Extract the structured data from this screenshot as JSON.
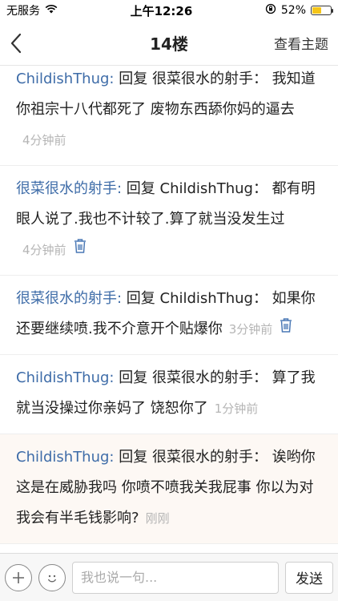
{
  "status_bar": {
    "carrier": "无服务",
    "time": "上午12:26",
    "battery_percent": "52%",
    "battery_level": 0.52,
    "icons": [
      "wifi-icon",
      "rotation-lock-icon",
      "battery-icon"
    ]
  },
  "nav": {
    "back_icon": "chevron-left-icon",
    "title": "14楼",
    "action_label": "查看主题"
  },
  "comments": [
    {
      "author": "ChildishThug:",
      "text": " 回复 很菜很水的射手： 我知道你祖宗十八代都死了 废物东西舔你妈的逼去",
      "time": "4分钟前",
      "deletable": false
    },
    {
      "author": "很菜很水的射手:",
      "text": " 回复 ChildishThug： 都有明眼人说了.我也不计较了.算了就当没发生过",
      "time": "4分钟前",
      "deletable": true
    },
    {
      "author": "很菜很水的射手:",
      "text": " 回复 ChildishThug： 如果你还要继续喷.我不介意开个贴爆你",
      "time": "3分钟前",
      "deletable": true
    },
    {
      "author": "ChildishThug:",
      "text": " 回复 很菜很水的射手： 算了我就当没操过你亲妈了 饶恕你了",
      "time": "1分钟前",
      "deletable": false
    },
    {
      "author": "ChildishThug:",
      "text": " 回复 很菜很水的射手： 诶哟你这是在威胁我吗 你喷不喷我关我屁事 你以为对我会有半毛钱影响?",
      "time": "刚刚",
      "deletable": false,
      "highlighted": true
    }
  ],
  "bottom_bar": {
    "add_icon": "plus-icon",
    "emoji_icon": "smiley-icon",
    "input_placeholder": "我也说一句...",
    "send_label": "发送"
  },
  "colors": {
    "author": "#3e6ca8",
    "time": "#b5b5b5",
    "battery": "#f5c518",
    "highlight_bg": "#fdf8f4"
  }
}
